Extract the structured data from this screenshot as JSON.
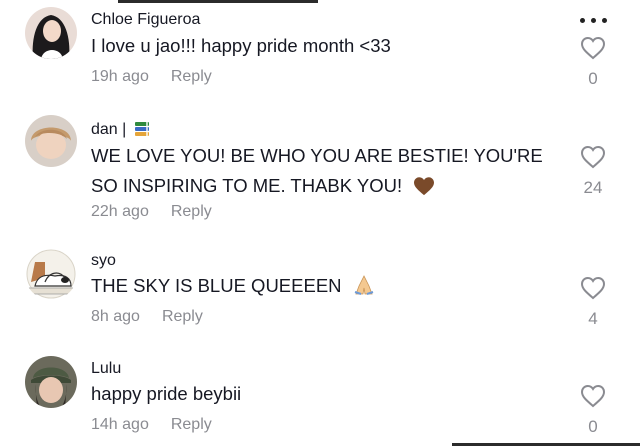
{
  "comments": [
    {
      "author": "Chloe Figueroa",
      "text": "I love u jao!!! happy pride month <33",
      "time": "19h ago",
      "reply": "Reply",
      "likes": "0",
      "avatar_icon": "person-avatar-icon"
    },
    {
      "author": "dan |",
      "text": "WE LOVE YOU! BE WHO YOU ARE BESTIE! YOU'RE SO INSPIRING TO ME. THABK YOU!",
      "time": "22h ago",
      "reply": "Reply",
      "likes": "24",
      "avatar_icon": "person-avatar-icon",
      "name_emoji": "books-icon",
      "text_emoji": "brown-heart-icon"
    },
    {
      "author": "syo",
      "text": "THE SKY IS BLUE QUEEEEN",
      "time": "8h ago",
      "reply": "Reply",
      "likes": "4",
      "avatar_icon": "snoopy-avatar-icon",
      "text_emoji": "folded-hands-icon"
    },
    {
      "author": "Lulu",
      "text": "happy pride beybii",
      "time": "14h ago",
      "reply": "Reply",
      "likes": "0",
      "avatar_icon": "person-avatar-icon"
    }
  ],
  "colors": {
    "primary_text": "#161823",
    "secondary_text": "#8a8b91"
  },
  "icons": [
    "more-icon",
    "heart-outline-icon"
  ]
}
